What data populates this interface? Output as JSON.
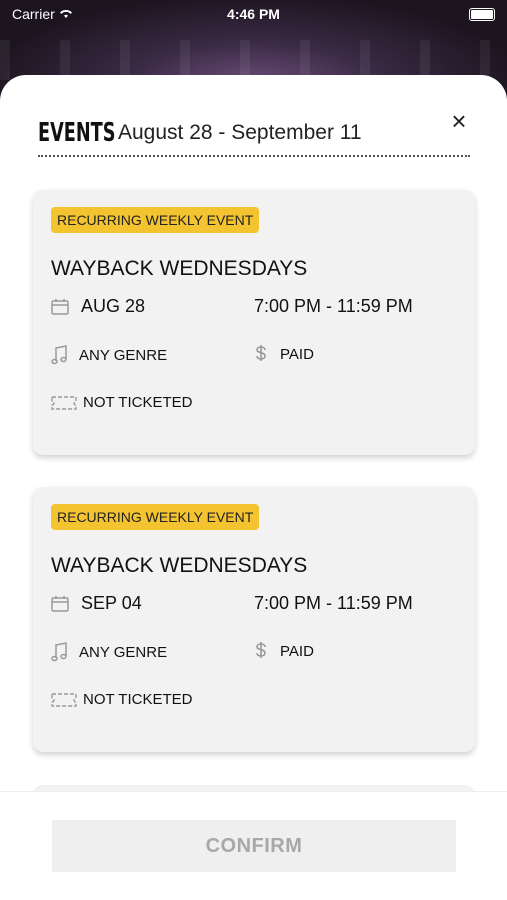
{
  "status_bar": {
    "carrier": "Carrier",
    "time": "4:46 PM"
  },
  "header": {
    "title": "EVENTS",
    "date_range": "August 28 - September 11",
    "close_label": "×"
  },
  "events": [
    {
      "badge": "RECURRING WEEKLY EVENT",
      "name": "WAYBACK WEDNESDAYS",
      "date": "AUG 28",
      "time": "7:00 PM - 11:59 PM",
      "genre": "ANY GENRE",
      "price": "PAID",
      "ticketing": "NOT TICKETED"
    },
    {
      "badge": "RECURRING WEEKLY EVENT",
      "name": "WAYBACK WEDNESDAYS",
      "date": "SEP 04",
      "time": "7:00 PM - 11:59 PM",
      "genre": "ANY GENRE",
      "price": "PAID",
      "ticketing": "NOT TICKETED"
    }
  ],
  "footer": {
    "confirm_label": "CONFIRM"
  },
  "colors": {
    "badge": "#f4c430",
    "card": "#f2f2f2",
    "confirm_bg": "#efefef",
    "confirm_text": "#a8a8a8"
  }
}
